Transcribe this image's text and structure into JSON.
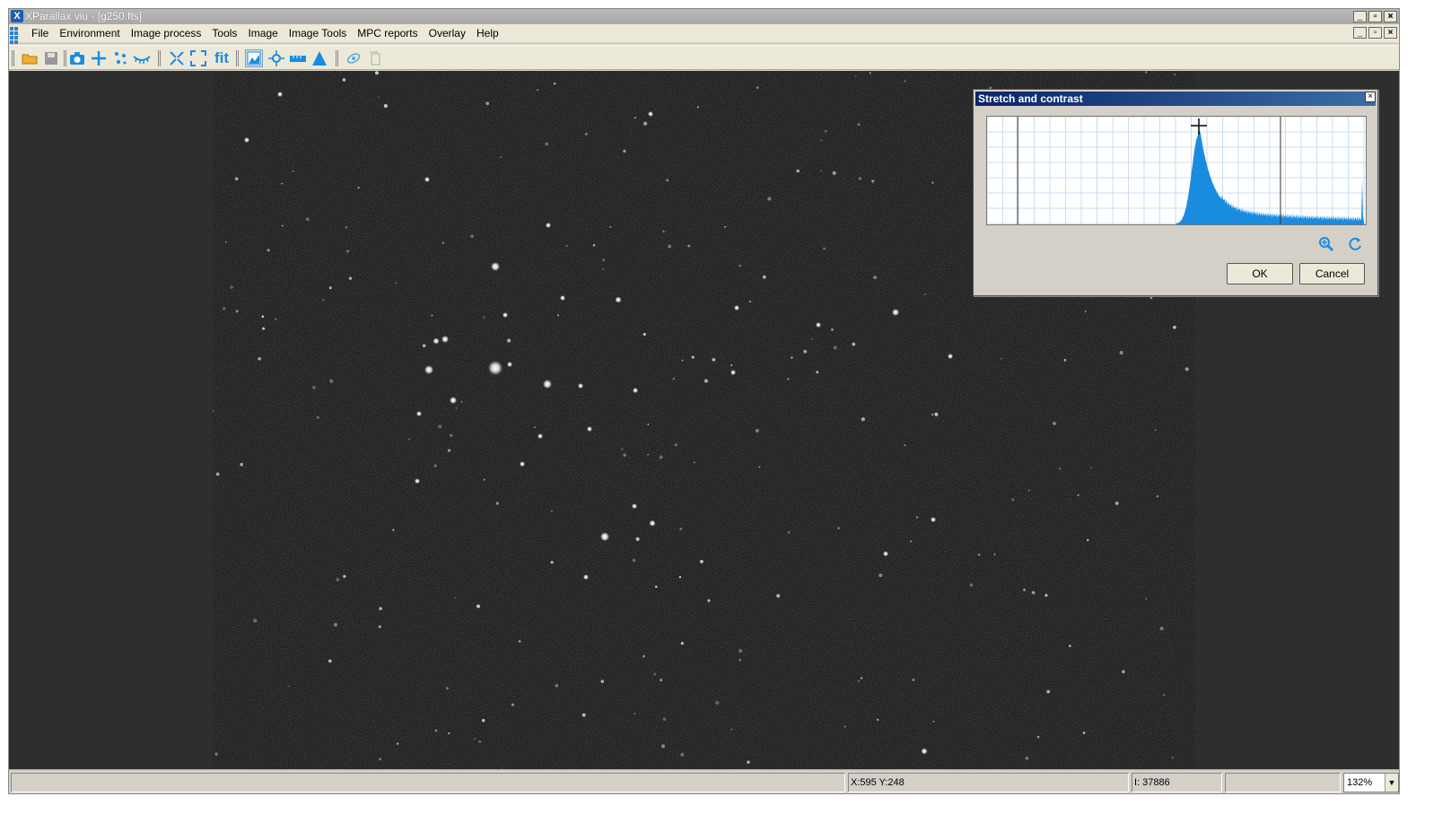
{
  "window": {
    "title": "XParallax viu - [g250.fts]"
  },
  "menu": [
    "File",
    "Environment",
    "Image process",
    "Tools",
    "Image",
    "Image Tools",
    "MPC reports",
    "Overlay",
    "Help"
  ],
  "toolbar": {
    "buttons": [
      "open-icon",
      "save-icon",
      "camera-icon",
      "crosshair-icon",
      "star-detect-icon",
      "blink-icon",
      "shrink-icon",
      "expand-icon",
      "fit-icon",
      "histogram-icon",
      "center-icon",
      "ruler-icon",
      "profile-icon",
      "orbit-icon",
      "copy-icon"
    ],
    "fit_label": "fit"
  },
  "status": {
    "coords": "X:595 Y:248",
    "intensity": "I: 37886",
    "zoom": "132%"
  },
  "dialog": {
    "title": "Stretch and contrast",
    "ok_label": "OK",
    "cancel_label": "Cancel"
  },
  "colors": {
    "histogram_fill": "#1a8ce0",
    "dialog_title_start": "#0a246a",
    "dialog_title_end": "#3a6ea5",
    "background": "#2e2e2e"
  }
}
